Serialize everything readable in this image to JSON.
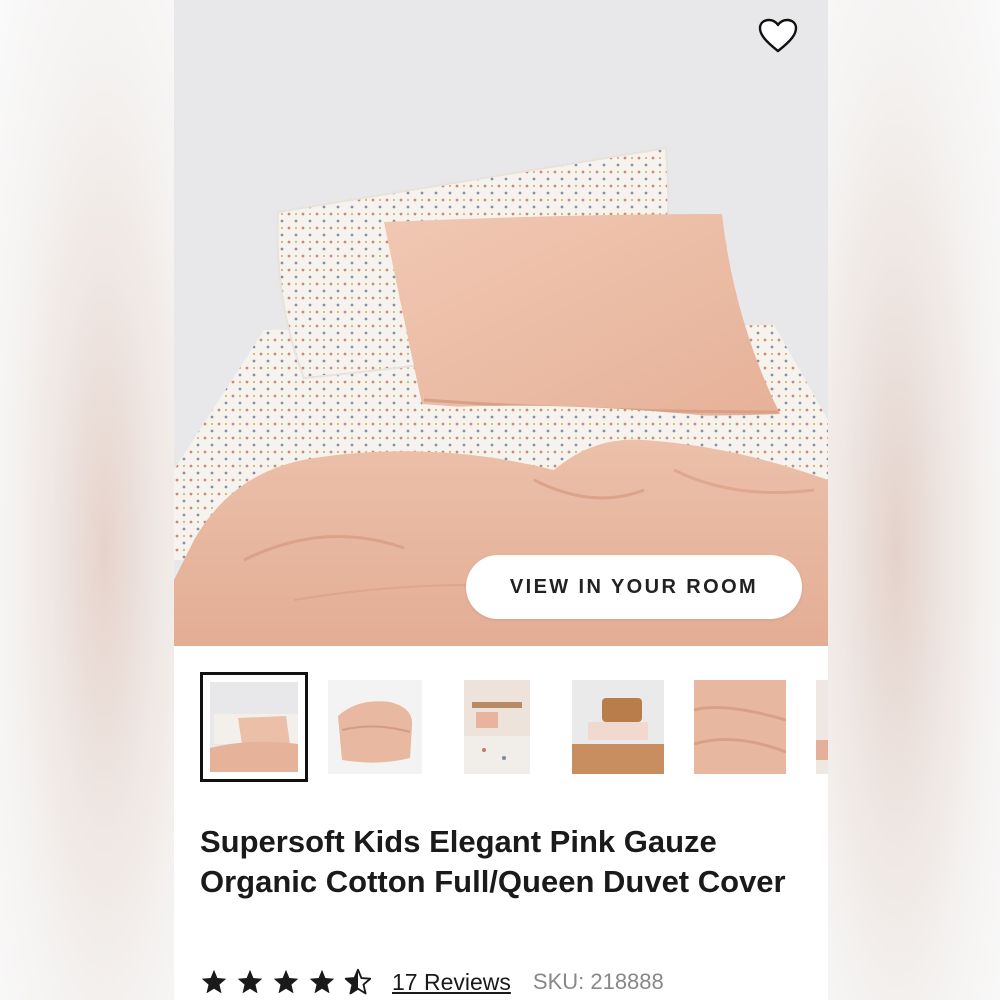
{
  "product": {
    "title": "Supersoft Kids Elegant Pink Gauze Organic Cotton Full/Queen Duvet Cover",
    "rating": 4.5,
    "rating_max": 5,
    "reviews_label": "17 Reviews",
    "sku_label": "SKU: 218888"
  },
  "hero": {
    "view_in_room_label": "VIEW IN YOUR ROOM",
    "favorite_icon": "heart-outline-icon"
  },
  "thumbnails": [
    {
      "name": "bed-styled",
      "selected": true
    },
    {
      "name": "folded-duvet",
      "selected": false
    },
    {
      "name": "room-shelf",
      "selected": false
    },
    {
      "name": "bed-pillows",
      "selected": false
    },
    {
      "name": "fabric-closeup",
      "selected": false
    },
    {
      "name": "partial-next",
      "selected": false
    }
  ],
  "colors": {
    "blush": "#e9b9a2",
    "blush_dark": "#d9a088",
    "wall": "#e7e7e9",
    "text": "#1a1a1a",
    "muted": "#888888"
  }
}
